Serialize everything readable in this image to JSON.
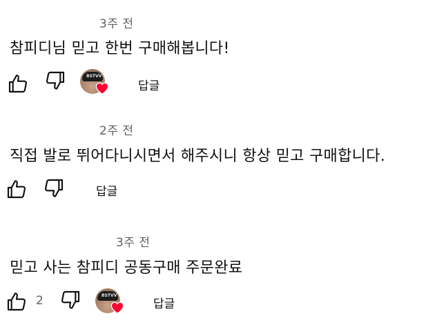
{
  "comments": [
    {
      "timestamp": "3주 전",
      "text": "참피디님 믿고 한번 구매해봅니다!",
      "like_count": "",
      "reply_label": "답글",
      "creator_heart": true
    },
    {
      "timestamp": "2주 전",
      "text": "직접 발로 뛰어다니시면서 해주시니 항상 믿고 구매합니다.",
      "like_count": "",
      "reply_label": "답글",
      "creator_heart": false
    },
    {
      "timestamp": "3주 전",
      "text": "믿고 사는 참피디 공동구매 주문완료",
      "like_count": "2",
      "reply_label": "답글",
      "creator_heart": true
    }
  ],
  "creator_avatar": {
    "cap_text": "BSTVV"
  },
  "colors": {
    "text": "#0f0f0f",
    "secondary_text": "#606060",
    "heart": "#ff0033"
  },
  "icons": {
    "like": "thumbs-up-icon",
    "dislike": "thumbs-down-icon",
    "heart": "heart-icon"
  }
}
